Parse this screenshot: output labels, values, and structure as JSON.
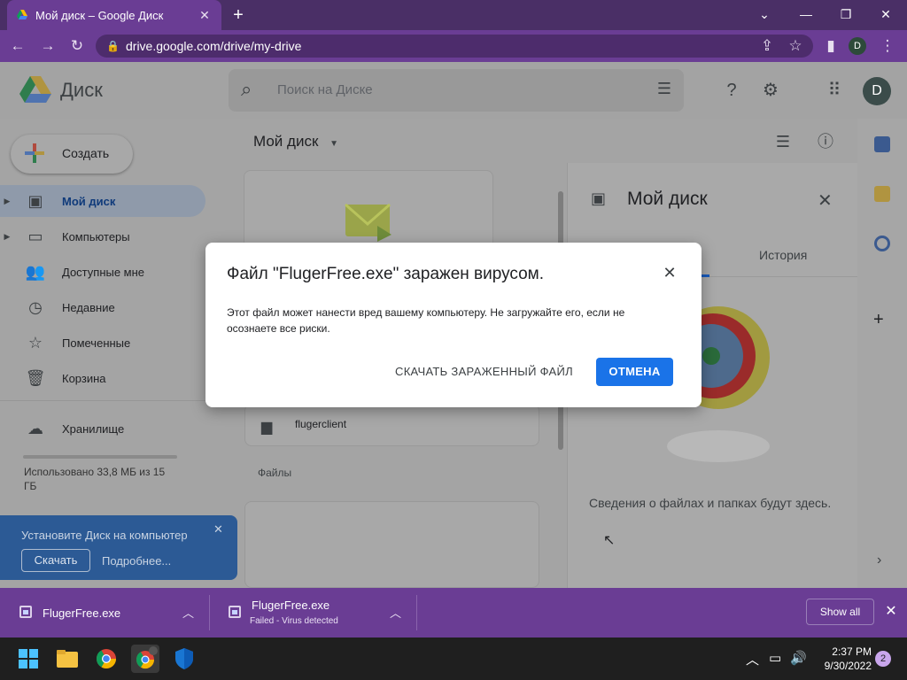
{
  "browser": {
    "tab_title": "Мой диск – Google Диск",
    "url": "drive.google.com/drive/my-drive",
    "profile_initial": "D"
  },
  "header": {
    "brand": "Диск",
    "search_placeholder": "Поиск на Диске",
    "account_initial": "D"
  },
  "sidebar": {
    "create_label": "Создать",
    "items": [
      {
        "label": "Мой диск",
        "icon": "drive-icon"
      },
      {
        "label": "Компьютеры",
        "icon": "computers-icon"
      },
      {
        "label": "Доступные мне",
        "icon": "people-icon"
      },
      {
        "label": "Недавние",
        "icon": "clock-icon"
      },
      {
        "label": "Помеченные",
        "icon": "star-icon"
      },
      {
        "label": "Корзина",
        "icon": "trash-icon"
      }
    ],
    "storage_label": "Хранилище",
    "storage_used": "Использовано 33,8 МБ из 15 ГБ"
  },
  "promo": {
    "text": "Установите Диск на компьютер",
    "download_label": "Скачать",
    "more_label": "Подробнее..."
  },
  "main": {
    "breadcrumb": "Мой диск",
    "folder_name": "flugerclient",
    "files_heading": "Файлы"
  },
  "details_panel": {
    "title": "Мой диск",
    "tab_history": "История",
    "info_text": "Сведения о файлах и папках будут здесь."
  },
  "dialog": {
    "title": "Файл \"FlugerFree.exe\" заражен вирусом.",
    "body": "Этот файл может нанести вред вашему компьютеру. Не загружайте его, если не осознаете все риски.",
    "download_anyway": "СКАЧАТЬ ЗАРАЖЕННЫЙ ФАЙЛ",
    "cancel": "ОТМЕНА"
  },
  "downloads": {
    "items": [
      {
        "name": "FlugerFree.exe",
        "status": ""
      },
      {
        "name": "FlugerFree.exe",
        "status": "Failed - Virus detected"
      }
    ],
    "show_all": "Show all"
  },
  "taskbar": {
    "time": "2:37 PM",
    "date": "9/30/2022",
    "notifications": "2"
  },
  "colors": {
    "accent": "#1a73e8",
    "browser_frame": "#6a3d94"
  }
}
